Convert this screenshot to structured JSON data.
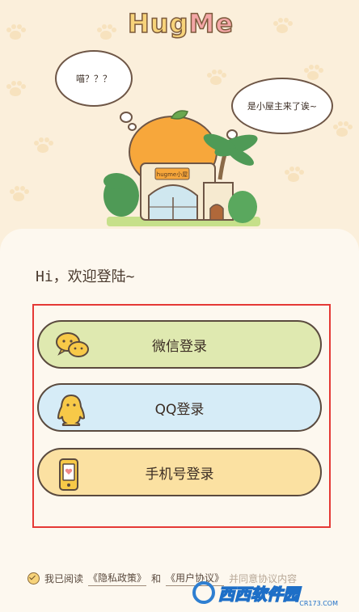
{
  "logo": {
    "part1": "Hug",
    "part2": "Me"
  },
  "clouds": {
    "left": "喵？？？",
    "right": "是小屋主来了诶~"
  },
  "house_sign": "hugme小屋",
  "greeting": "Hi，欢迎登陆~",
  "buttons": {
    "wechat": {
      "label": "微信登录",
      "icon": "wechat-icon"
    },
    "qq": {
      "label": "QQ登录",
      "icon": "qq-penguin-icon"
    },
    "phone": {
      "label": "手机号登录",
      "icon": "phone-icon"
    }
  },
  "agreement": {
    "prefix": "我已阅读",
    "privacy": "《隐私政策》",
    "and": "和",
    "terms": "《用户协议》",
    "suffix": "并同意协议内容"
  },
  "watermark": {
    "text": "西西软件园",
    "url": "CR173.COM"
  },
  "colors": {
    "wechat_bg": "#dfe9b0",
    "qq_bg": "#d6ecf7",
    "phone_bg": "#fbe1a2",
    "highlight": "#e53935"
  }
}
